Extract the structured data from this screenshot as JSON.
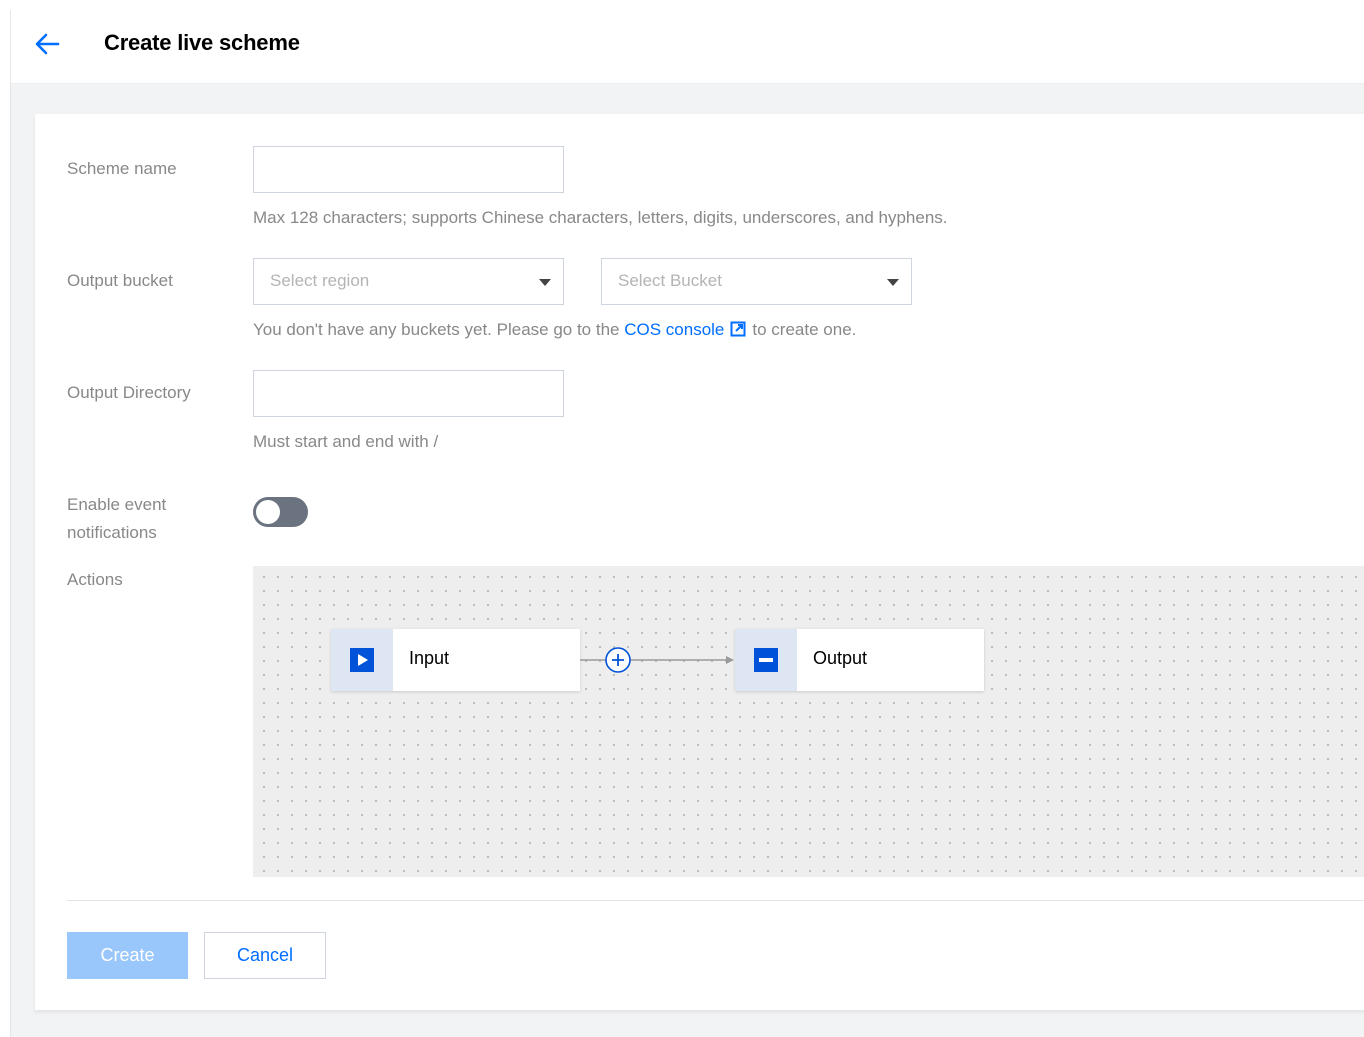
{
  "header": {
    "title": "Create live scheme"
  },
  "form": {
    "scheme_name": {
      "label": "Scheme name",
      "value": "",
      "help": "Max 128 characters; supports Chinese characters, letters, digits, underscores, and hyphens."
    },
    "output_bucket": {
      "label": "Output bucket",
      "region_placeholder": "Select region",
      "bucket_placeholder": "Select Bucket",
      "help_prefix": "You don't have any buckets yet. Please go to the",
      "help_link": "COS console",
      "help_suffix": "to create one."
    },
    "output_directory": {
      "label": "Output Directory",
      "value": "",
      "help": "Must start and end with /"
    },
    "event_notifications": {
      "label_line1": "Enable event",
      "label_line2": "notifications",
      "enabled": false
    },
    "actions": {
      "label": "Actions",
      "input_node": "Input",
      "output_node": "Output"
    }
  },
  "footer": {
    "create_label": "Create",
    "cancel_label": "Cancel"
  },
  "colors": {
    "accent": "#006eff",
    "node_icon": "#0052d9",
    "create_disabled": "#99c6fb",
    "toggle_off": "#6b7380"
  },
  "icons": {
    "back": "arrow-left-icon",
    "external": "external-link-icon",
    "input": "play-icon",
    "output": "output-icon",
    "add": "plus-circle-icon",
    "caret": "chevron-down-icon"
  }
}
